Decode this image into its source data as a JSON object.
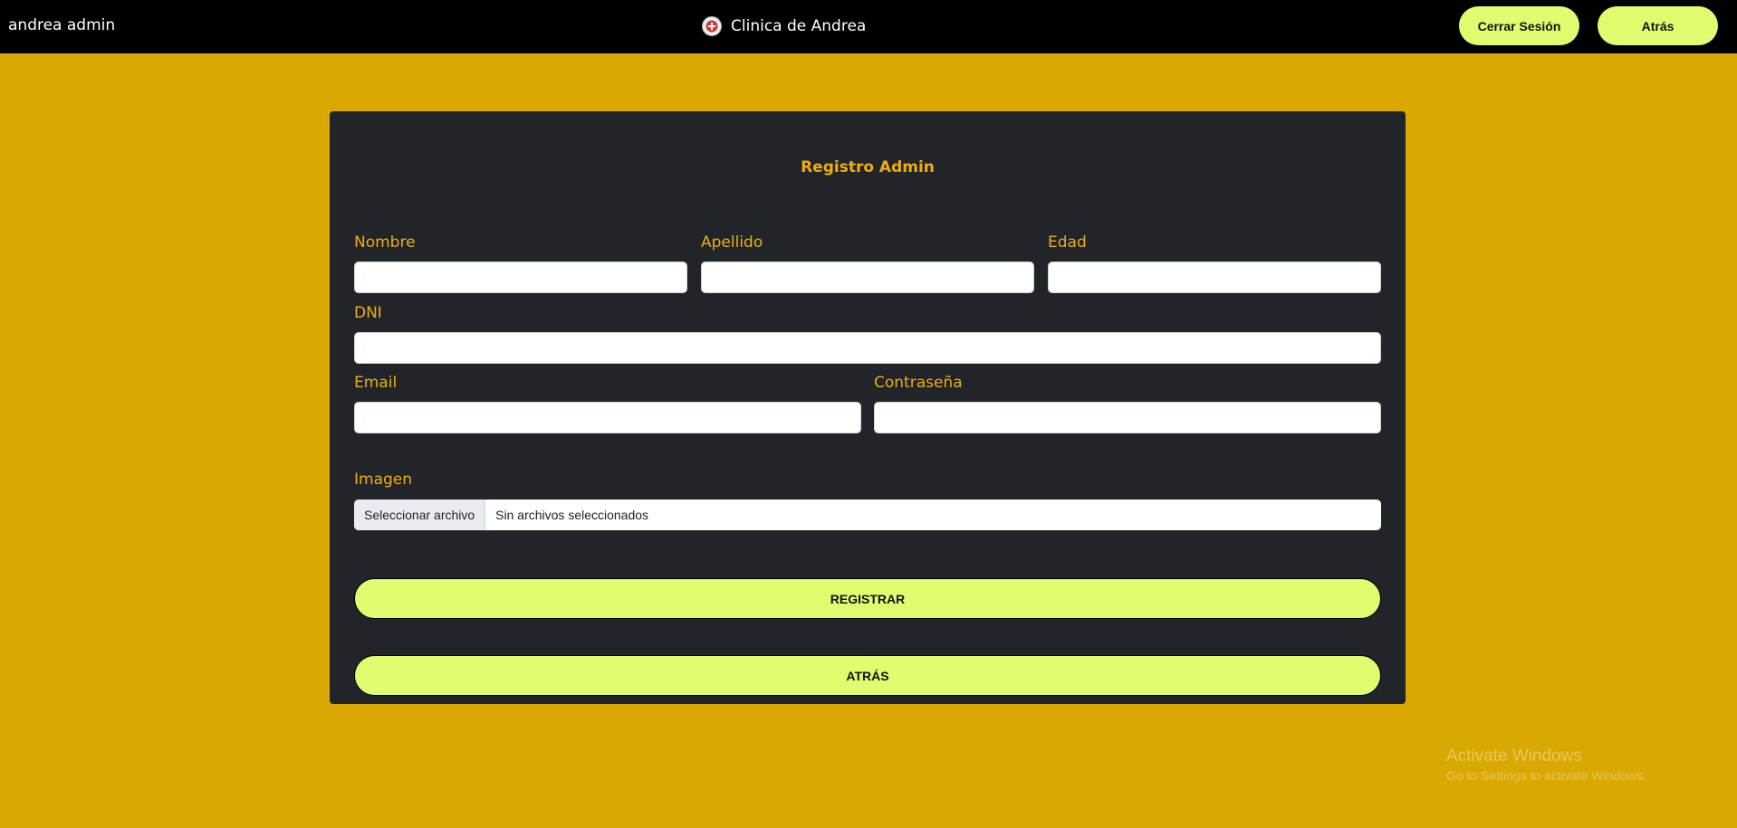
{
  "navbar": {
    "user_name": "andrea admin",
    "brand_name": "Clinica de Andrea",
    "logo_icon": "clinic-logo-icon",
    "logout_label": "Cerrar Sesión",
    "back_label": "Atrás"
  },
  "form": {
    "title": "Registro Admin",
    "fields": {
      "nombre": {
        "label": "Nombre",
        "value": ""
      },
      "apellido": {
        "label": "Apellido",
        "value": ""
      },
      "edad": {
        "label": "Edad",
        "value": ""
      },
      "dni": {
        "label": "DNI",
        "value": ""
      },
      "email": {
        "label": "Email",
        "value": ""
      },
      "contrasena": {
        "label": "Contraseña",
        "value": ""
      },
      "imagen": {
        "label": "Imagen",
        "button_label": "Seleccionar archivo",
        "status": "Sin archivos seleccionados"
      }
    },
    "submit_label": "REGISTRAR",
    "back_label": "ATRÁS"
  },
  "watermark": {
    "title": "Activate Windows",
    "subtitle": "Go to Settings to activate Windows."
  },
  "colors": {
    "page_background": "#daa803",
    "navbar_background": "#000000",
    "card_background": "#212429",
    "label_color": "#f0ad10",
    "button_accent": "#e0fd70"
  }
}
